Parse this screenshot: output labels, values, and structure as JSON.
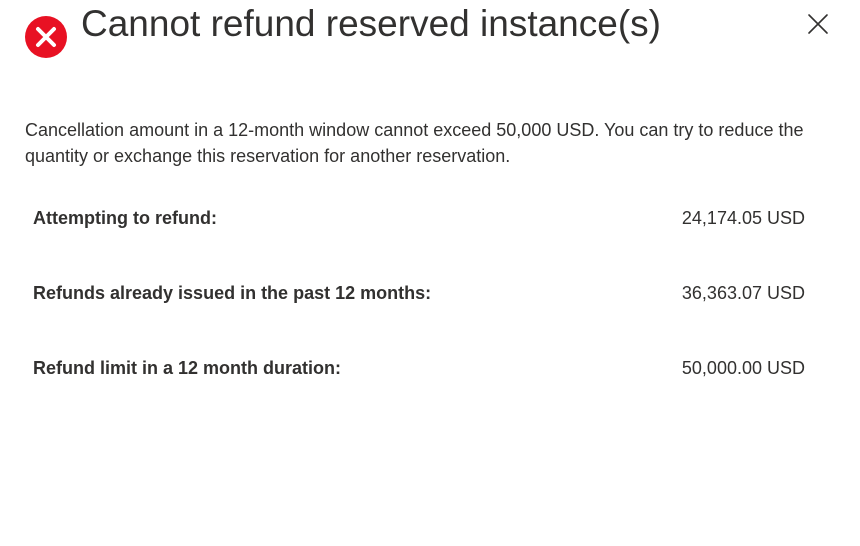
{
  "dialog": {
    "title": "Cannot refund reserved instance(s)",
    "icon": "error-circle-icon",
    "close_icon": "close-icon",
    "message": "Cancellation amount in a 12-month window cannot exceed 50,000 USD. You can try to reduce the quantity or exchange this reservation for another reservation.",
    "rows": [
      {
        "label": "Attempting to refund:",
        "value": "24,174.05 USD"
      },
      {
        "label": "Refunds already issued in the past 12 months:",
        "value": "36,363.07 USD"
      },
      {
        "label": "Refund limit in a 12 month duration:",
        "value": "50,000.00 USD"
      }
    ]
  },
  "colors": {
    "error_red": "#e81123",
    "text": "#323130"
  }
}
